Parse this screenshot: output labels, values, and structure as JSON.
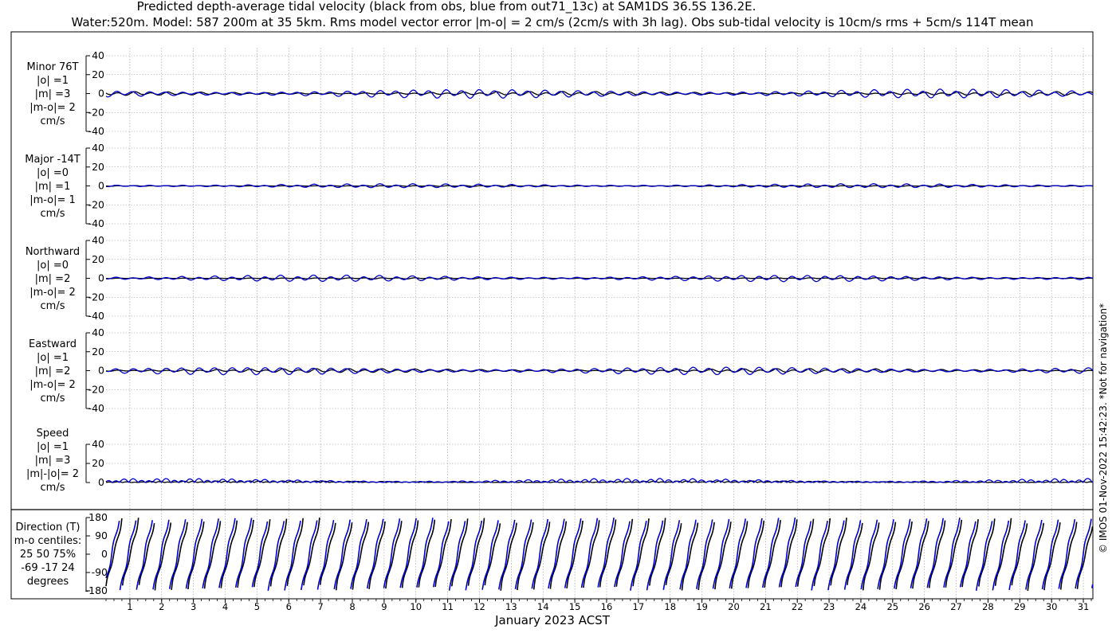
{
  "title_line1": "Predicted depth-average tidal velocity (black from obs, blue from out71_13c) at SAM1DS 36.5S 136.2E.",
  "title_line2": "Water:520m. Model: 587 200m at 35 5km. Rms model vector error |m-o| = 2 cm/s (2cm/s with 3h lag). Obs sub-tidal velocity is 10cm/s rms + 5cm/s 114T mean",
  "side_text": "© IMOS 01-Nov-2022 15:42:23. *Not for navigation*",
  "colors": {
    "obs": "#000000",
    "model": "#0000cc",
    "grid": "#999999"
  },
  "chart_data": {
    "type": "line",
    "xlabel": "January 2023 ACST",
    "x_ticks": [
      "1",
      "2",
      "3",
      "4",
      "5",
      "6",
      "7",
      "8",
      "9",
      "10",
      "11",
      "12",
      "13",
      "14",
      "15",
      "16",
      "17",
      "18",
      "19",
      "20",
      "21",
      "22",
      "23",
      "24",
      "25",
      "26",
      "27",
      "28",
      "29",
      "30",
      "31"
    ],
    "xlim": [
      0.25,
      31.3
    ],
    "grid": true,
    "series_legend": {
      "obs": "black from obs",
      "model": "blue from out71_13c"
    },
    "panels": [
      {
        "label_lines": [
          "Minor 76T",
          "|o| =1",
          "|m| =3",
          "|m-o|= 2",
          "cm/s"
        ],
        "yticks": [
          "40",
          "20",
          "0",
          "-20",
          "-40"
        ],
        "ylim": [
          -40,
          40
        ],
        "obs_amp": 1.5,
        "model_amp": 3.5,
        "unit": "cm/s"
      },
      {
        "label_lines": [
          "Major -14T",
          "|o| =0",
          "|m| =1",
          "|m-o|= 1",
          "cm/s"
        ],
        "yticks": [
          "40",
          "20",
          "0",
          "-20",
          "-40"
        ],
        "ylim": [
          -40,
          40
        ],
        "obs_amp": 0.4,
        "model_amp": 1.6,
        "unit": "cm/s"
      },
      {
        "label_lines": [
          "Northward",
          "|o| =0",
          "|m| =2",
          "|m-o|= 2",
          "cm/s"
        ],
        "yticks": [
          "40",
          "20",
          "0",
          "-20",
          "-40"
        ],
        "ylim": [
          -40,
          40
        ],
        "obs_amp": 0.5,
        "model_amp": 2.5,
        "unit": "cm/s"
      },
      {
        "label_lines": [
          "Eastward",
          "|o| =1",
          "|m| =2",
          "|m-o|= 2",
          "cm/s"
        ],
        "yticks": [
          "40",
          "20",
          "0",
          "-20",
          "-40"
        ],
        "ylim": [
          -40,
          40
        ],
        "obs_amp": 1.5,
        "model_amp": 3.0,
        "unit": "cm/s"
      },
      {
        "label_lines": [
          "Speed",
          "|o| =1",
          "|m| =3",
          "|m|-|o|= 2",
          "cm/s"
        ],
        "yticks": [
          "40",
          "20",
          "0"
        ],
        "ylim": [
          0,
          40
        ],
        "obs_amp": 1.2,
        "model_amp": 3.0,
        "unit": "cm/s"
      }
    ],
    "direction_panel": {
      "label_lines": [
        "Direction (T)",
        "m-o centiles:",
        "25  50  75%",
        "-69 -17  24",
        "degrees"
      ],
      "yticks": [
        "180",
        "90",
        "0",
        "-90",
        "-180"
      ],
      "ylim": [
        -180,
        180
      ],
      "centiles": {
        "p25": -69,
        "p50": -17,
        "p75": 24
      }
    }
  }
}
